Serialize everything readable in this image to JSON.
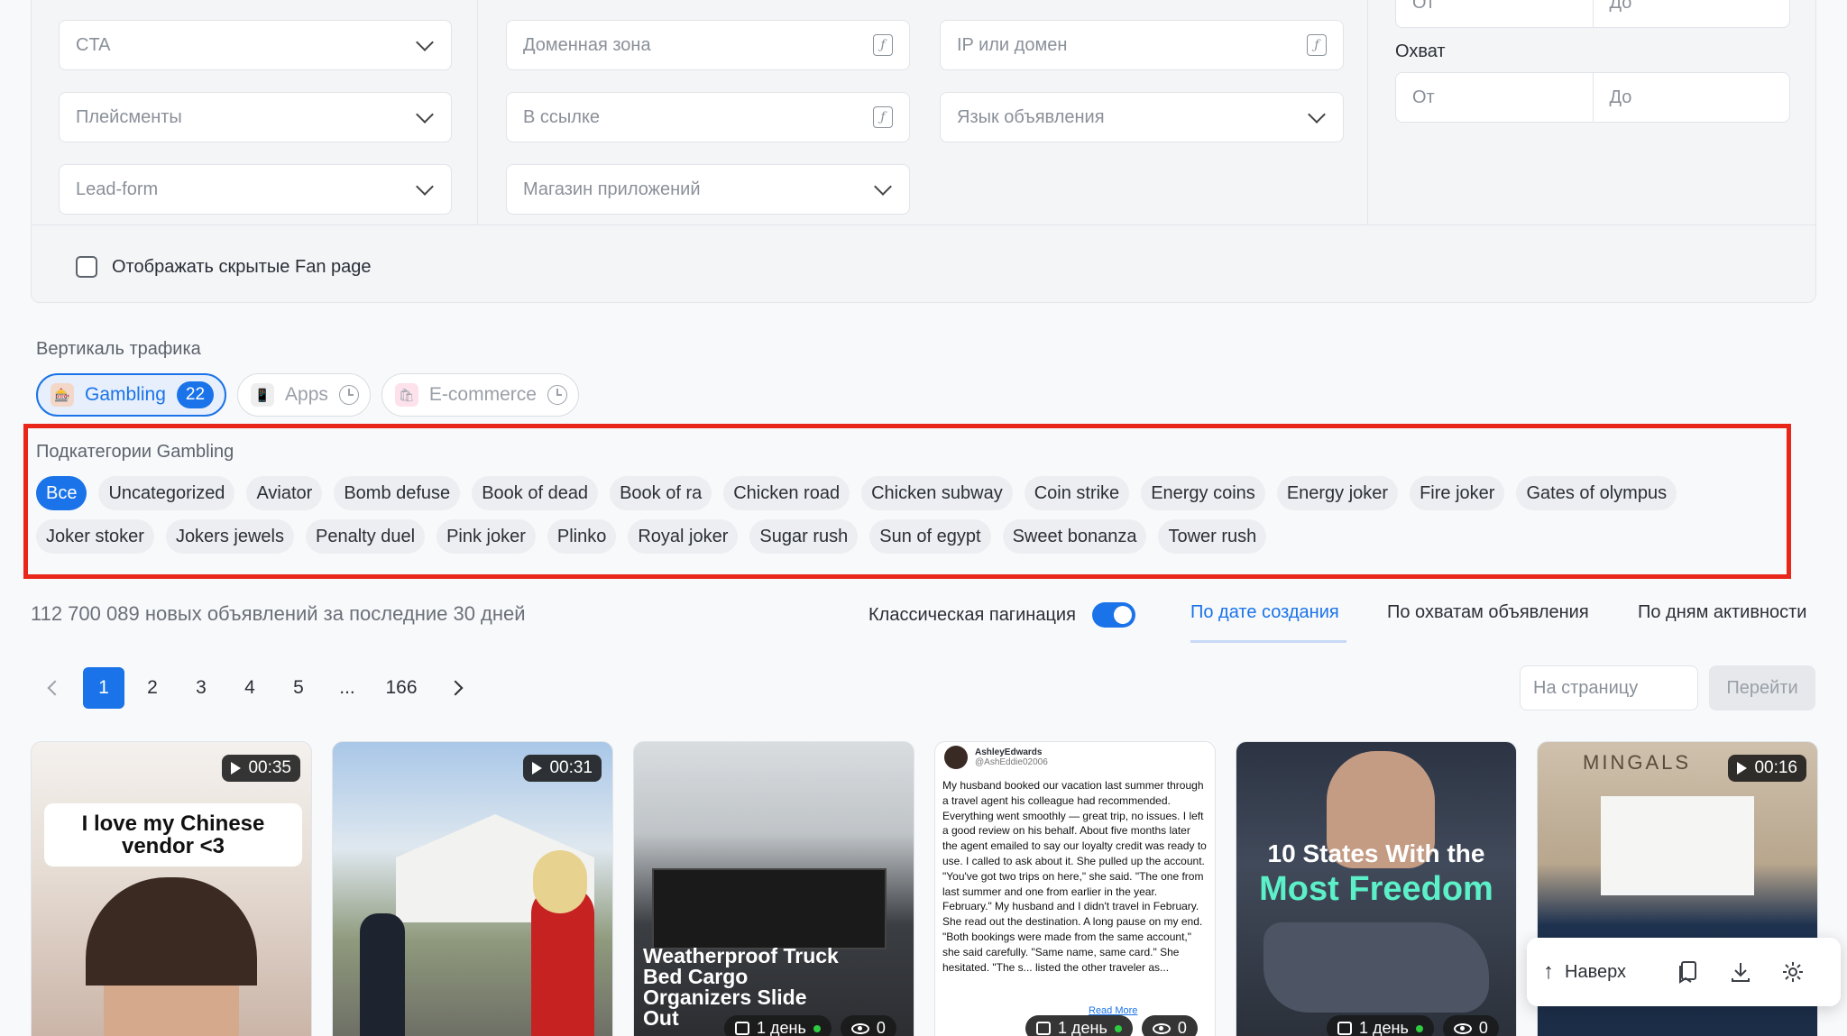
{
  "filters": {
    "cta": "CTA",
    "placements": "Плейсменты",
    "lead_form": "Lead-form",
    "domain_zone": "Доменная зона",
    "in_link": "В ссылке",
    "app_store": "Магазин приложений",
    "ip_domain": "IP или домен",
    "ad_language": "Язык объявления",
    "range_top_from": "От",
    "range_top_to": "До",
    "reach_label": "Охват",
    "reach_from": "От",
    "reach_to": "До",
    "formula_icon": "ƒ"
  },
  "show_hidden": "Отображать скрытые Fan page",
  "verticals": {
    "title": "Вертикаль трафика",
    "items": [
      {
        "label": "Gambling",
        "count": "22",
        "icon": "slot-machine-icon"
      },
      {
        "label": "Apps",
        "icon": "phone-icon"
      },
      {
        "label": "E-commerce",
        "icon": "shopping-bag-icon"
      }
    ]
  },
  "subcategories": {
    "title": "Подкатегории Gambling",
    "items": [
      "Все",
      "Uncategorized",
      "Aviator",
      "Bomb defuse",
      "Book of dead",
      "Book of ra",
      "Chicken road",
      "Chicken subway",
      "Coin strike",
      "Energy coins",
      "Energy joker",
      "Fire joker",
      "Gates of olympus",
      "Joker stoker",
      "Jokers jewels",
      "Penalty duel",
      "Pink joker",
      "Plinko",
      "Royal joker",
      "Sugar rush",
      "Sun of egypt",
      "Sweet bonanza",
      "Tower rush"
    ]
  },
  "results": {
    "stats": "112 700 089 новых объявлений за последние 30 дней",
    "classic_pagination": "Классическая пагинация",
    "sort_by_date": "По дате создания",
    "sort_by_reach": "По охватам объявления",
    "sort_by_activity": "По дням активности"
  },
  "pagination": {
    "pages": [
      "1",
      "2",
      "3",
      "4",
      "5",
      "...",
      "166"
    ],
    "per_page_placeholder": "На страницу",
    "go": "Перейти"
  },
  "cards": [
    {
      "duration": "00:35",
      "caption": "I love my Chinese vendor <3"
    },
    {
      "duration": "00:31"
    },
    {
      "title": "Weatherproof Truck Bed Cargo Organizers Slide Out",
      "days": "1 день",
      "views": "0"
    },
    {
      "author": "AshleyEdwards",
      "handle": "@AshEddie02006",
      "text": "My husband booked our vacation last summer through a travel agent his colleague had recommended. Everything went smoothly — great trip, no issues. I left a good review on his behalf. About five months later the agent emailed to say our loyalty credit was ready to use. I called to ask about it. She pulled up the account. \"You've got two trips on here,\" she said. \"The one from last summer and one from earlier in the year. February.\" My husband and I didn't travel in February. She read out the destination. A long pause on my end. \"Both bookings were made from the same account,\" she said carefully. \"Same name, same card.\" She hesitated. \"The s... listed the other traveler as...",
      "read_more": "Read More",
      "days": "1 день",
      "views": "0"
    },
    {
      "title_line1": "10 States With the",
      "title_line2": "Most Freedom",
      "days": "1 день",
      "views": "0"
    },
    {
      "duration": "00:16",
      "brand": "MINGALS"
    }
  ],
  "float_bar": {
    "up_label": "Наверх"
  },
  "colors": {
    "accent": "#1a73e8",
    "highlight_border": "#e8261a"
  }
}
